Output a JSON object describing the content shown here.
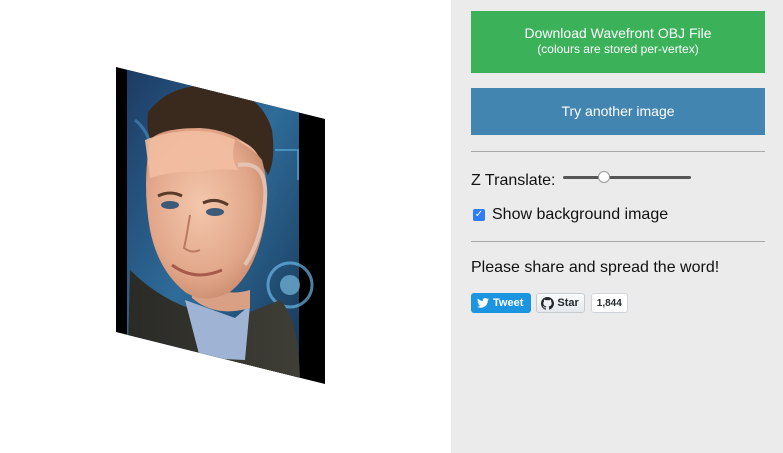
{
  "viewport": {
    "portrait_description_icon": "3d-face-mesh"
  },
  "panel": {
    "download_button": {
      "label": "Download Wavefront OBJ File",
      "sublabel": "(colours are stored per-vertex)",
      "color": "#3bb25a"
    },
    "try_button": {
      "label": "Try another image",
      "color": "#4385b1"
    },
    "z_translate": {
      "label": "Z Translate:",
      "value": 0.3
    },
    "background_toggle": {
      "label": "Show background image",
      "checked": true
    },
    "share_text": "Please share and spread the word!",
    "social": {
      "tweet_label": "Tweet",
      "star_label": "Star",
      "star_count": "1,844"
    }
  }
}
